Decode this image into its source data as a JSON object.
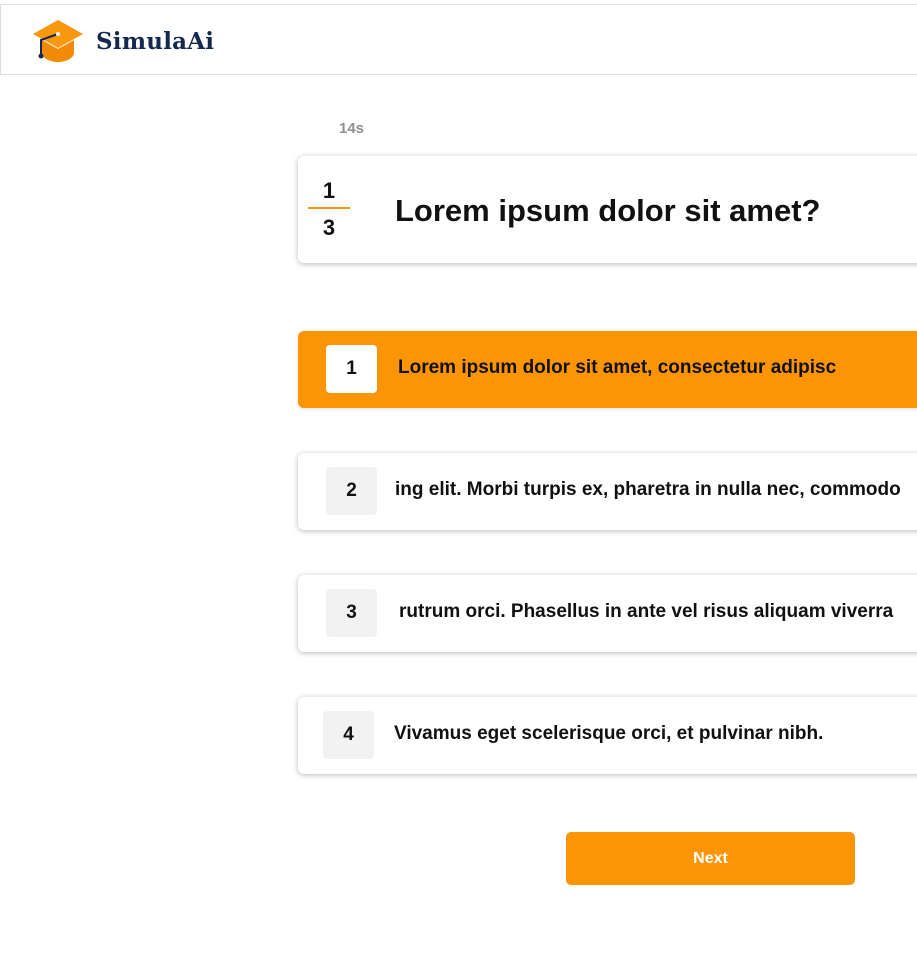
{
  "brand": {
    "name": "SimulaAi",
    "icon": "graduation-cap-icon",
    "color": "#fc9506",
    "text_color": "#132a4e"
  },
  "quiz": {
    "timer": "14s",
    "progress": {
      "current": "1",
      "total": "3"
    },
    "question": "Lorem ipsum dolor sit amet?",
    "answers": [
      {
        "number": "1",
        "text": "Lorem ipsum dolor sit amet, consectetur adipisc",
        "selected": true
      },
      {
        "number": "2",
        "text": "ing elit. Morbi turpis ex, pharetra in nulla nec, commodo",
        "selected": false
      },
      {
        "number": "3",
        "text": "rutrum orci. Phasellus in ante vel risus aliquam viverra",
        "selected": false
      },
      {
        "number": "4",
        "text": "Vivamus eget scelerisque orci, et pulvinar nibh.",
        "selected": false
      }
    ],
    "next_label": "Next"
  },
  "colors": {
    "accent": "#fc9506",
    "badge_bg": "#f3f2f3",
    "timer": "#8f8f8f"
  }
}
